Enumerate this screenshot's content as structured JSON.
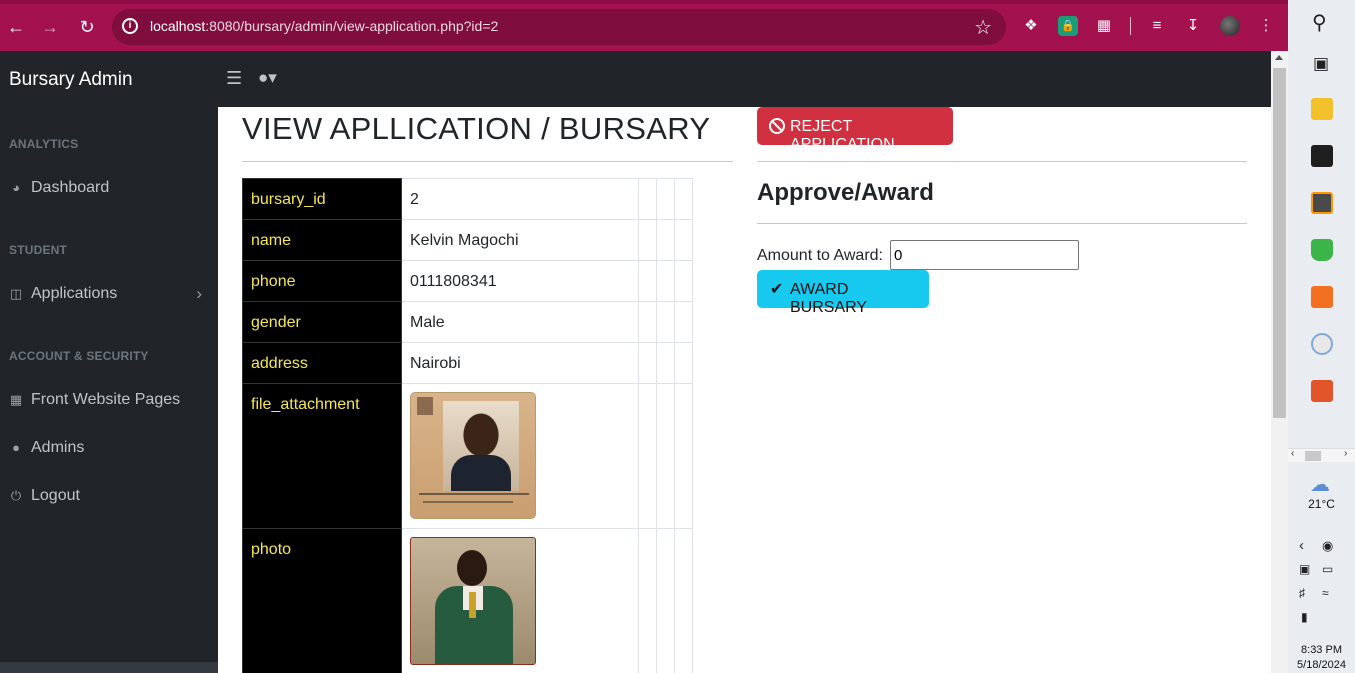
{
  "browser": {
    "url_host": "localhost",
    "url_rest": ":8080/bursary/admin/view-application.php?id=2"
  },
  "sidebar": {
    "brand": "Bursary Admin",
    "sections": [
      {
        "heading": "ANALYTICS",
        "items": [
          {
            "label": "Dashboard",
            "icon": "dashboard-icon"
          }
        ]
      },
      {
        "heading": "STUDENT",
        "items": [
          {
            "label": "Applications",
            "icon": "columns-icon"
          }
        ]
      },
      {
        "heading": "ACCOUNT & SECURITY",
        "items": [
          {
            "label": "Front Website Pages",
            "icon": "table-icon"
          },
          {
            "label": "Admins",
            "icon": "user-icon"
          },
          {
            "label": "Logout",
            "icon": "power-icon"
          }
        ]
      }
    ]
  },
  "main": {
    "title": "VIEW APLLICATION / BURSARY",
    "fields": [
      {
        "key": "bursary_id",
        "value": "2"
      },
      {
        "key": "name",
        "value": "Kelvin Magochi"
      },
      {
        "key": "phone",
        "value": "0111808341"
      },
      {
        "key": "gender",
        "value": "Male"
      },
      {
        "key": "address",
        "value": "Nairobi"
      },
      {
        "key": "file_attachment",
        "value": ""
      },
      {
        "key": "photo",
        "value": ""
      }
    ]
  },
  "actions": {
    "reject_label": "REJECT APPLICATION",
    "section_title": "Approve/Award",
    "amount_label": "Amount to Award:",
    "amount_value": "0",
    "award_label": "AWARD BURSARY"
  },
  "taskbar": {
    "temperature": "21°C",
    "time": "8:33 PM",
    "date": "5/18/2024"
  },
  "colors": {
    "browser_frame": "#a3114f",
    "sidebar_bg": "#212529",
    "key_text": "#f5e65a",
    "reject": "#d0303f",
    "award": "#17c8ef"
  }
}
